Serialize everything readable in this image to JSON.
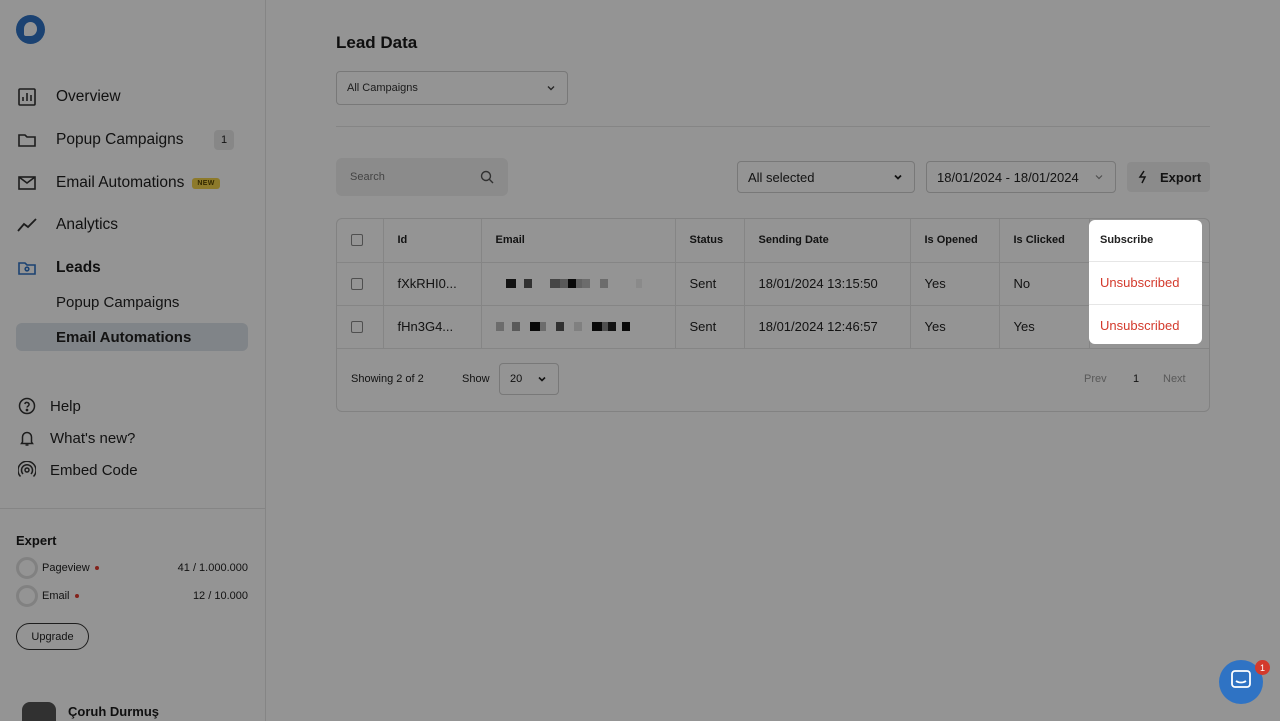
{
  "sidebar": {
    "nav": [
      {
        "label": "Overview",
        "icon": "chart-icon"
      },
      {
        "label": "Popup Campaigns",
        "icon": "folder-icon",
        "badge": "1"
      },
      {
        "label": "Email Automations",
        "icon": "mail-icon",
        "badge": "NEW"
      },
      {
        "label": "Analytics",
        "icon": "trend-icon"
      },
      {
        "label": "Leads",
        "icon": "leads-folder-icon"
      }
    ],
    "leads_sub": [
      {
        "label": "Popup Campaigns"
      },
      {
        "label": "Email Automations"
      }
    ],
    "help": [
      {
        "label": "Help",
        "icon": "help-icon"
      },
      {
        "label": "What's new?",
        "icon": "bell-icon"
      },
      {
        "label": "Embed Code",
        "icon": "embed-icon"
      }
    ],
    "plan": {
      "title": "Expert",
      "pageview_label": "Pageview",
      "pageview_value": "41 / 1.000.000",
      "email_label": "Email",
      "email_value": "12 / 10.000",
      "upgrade_label": "Upgrade"
    },
    "user": {
      "name": "Çoruh Durmuş"
    }
  },
  "main": {
    "title": "Lead Data",
    "campaign_select": "All Campaigns",
    "search_placeholder": "Search",
    "status_select": "All selected",
    "date_range": "18/01/2024 - 18/01/2024",
    "export_label": "Export",
    "table": {
      "headers": [
        "Id",
        "Email",
        "Status",
        "Sending Date",
        "Is Opened",
        "Is Clicked",
        "Subscribe"
      ],
      "rows": [
        {
          "id": "fXkRHI0...",
          "status": "Sent",
          "date": "18/01/2024 13:15:50",
          "opened": "Yes",
          "clicked": "No",
          "subscribe": "Unsubscribed"
        },
        {
          "id": "fHn3G4...",
          "status": "Sent",
          "date": "18/01/2024 12:46:57",
          "opened": "Yes",
          "clicked": "Yes",
          "subscribe": "Unsubscribed"
        }
      ]
    },
    "footer": {
      "showing": "Showing 2 of 2",
      "show_label": "Show",
      "page_size": "20",
      "prev": "Prev",
      "page": "1",
      "next": "Next"
    }
  },
  "chat": {
    "badge": "1"
  },
  "colors": {
    "accent": "#2f73c4",
    "danger": "#d33a2c",
    "active_bg": "#dde3ea"
  }
}
